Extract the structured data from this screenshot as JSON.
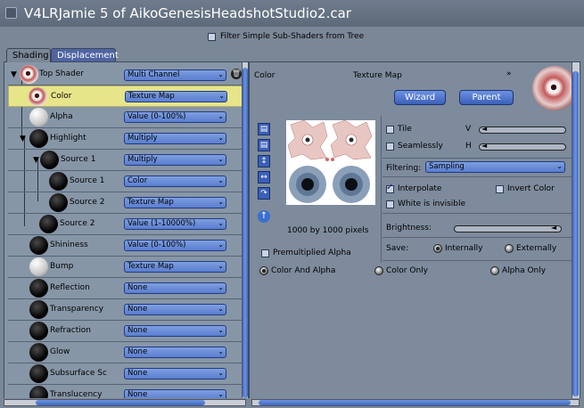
{
  "window": {
    "title": "V4LRJamie 5 of AikoGenesisHeadshotStudio2.car"
  },
  "filter": {
    "label": "Filter Simple Sub-Shaders from Tree",
    "checked": false
  },
  "tabs": [
    {
      "label": "Shading",
      "active": true
    },
    {
      "label": "Displacement",
      "active": false
    }
  ],
  "tree": [
    {
      "label": "Top Shader",
      "value": "Multi Channel",
      "sphere": "eye"
    },
    {
      "label": "Color",
      "value": "Texture Map",
      "sphere": "eye",
      "selected": true
    },
    {
      "label": "Alpha",
      "value": "Value (0-100%)",
      "sphere": "white"
    },
    {
      "label": "Highlight",
      "value": "Multiply",
      "sphere": "black"
    },
    {
      "label": "Source 1",
      "value": "Multiply",
      "sphere": "black"
    },
    {
      "label": "Source 1",
      "value": "Color",
      "sphere": "black"
    },
    {
      "label": "Source 2",
      "value": "Texture Map",
      "sphere": "black"
    },
    {
      "label": "Source 2",
      "value": "Value (1-10000%)",
      "sphere": "black"
    },
    {
      "label": "Shininess",
      "value": "Value (0-100%)",
      "sphere": "black"
    },
    {
      "label": "Bump",
      "value": "Texture Map",
      "sphere": "white"
    },
    {
      "label": "Reflection",
      "value": "None",
      "sphere": "black"
    },
    {
      "label": "Transparency",
      "value": "None",
      "sphere": "black"
    },
    {
      "label": "Refraction",
      "value": "None",
      "sphere": "black"
    },
    {
      "label": "Glow",
      "value": "None",
      "sphere": "black"
    },
    {
      "label": "Subsurface Sc",
      "value": "None",
      "sphere": "black"
    },
    {
      "label": "Translucency",
      "value": "None",
      "sphere": "black"
    }
  ],
  "right": {
    "channel": "Color",
    "shader_type": "Texture Map",
    "wizard_label": "Wizard",
    "parent_label": "Parent",
    "texture_size": "1000 by 1000 pixels",
    "tile_label": "Tile",
    "seamlessly_label": "Seamlessly",
    "v_label": "V",
    "h_label": "H",
    "filtering_label": "Filtering:",
    "filtering_value": "Sampling",
    "interpolate_label": "Interpolate",
    "invert_color_label": "Invert Color",
    "white_invisible_label": "White is invisible",
    "brightness_label": "Brightness:",
    "save_label": "Save:",
    "internally_label": "Internally",
    "externally_label": "Externally",
    "premultiplied_label": "Premultiplied Alpha",
    "color_and_alpha_label": "Color And Alpha",
    "color_only_label": "Color Only",
    "alpha_only_label": "Alpha Only"
  }
}
